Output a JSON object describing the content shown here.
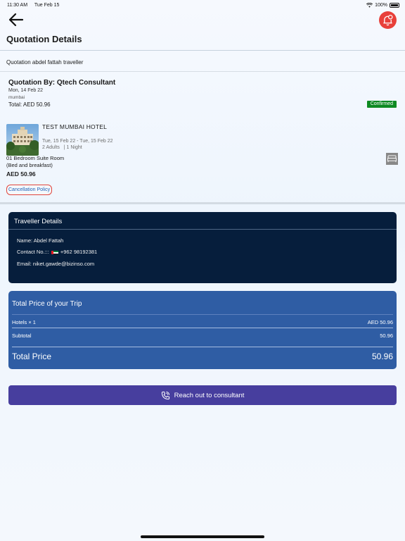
{
  "status_bar": {
    "time": "11:30 AM",
    "date": "Tue Feb 15",
    "battery": "100%"
  },
  "header": {
    "title": "Quotation Details"
  },
  "quotation": {
    "name": "Quotation abdel fattah traveller",
    "by": "Quotation By: Qtech Consultant",
    "date": "Mon, 14 Feb 22",
    "city": "mumbai",
    "total": "Total: AED 50.96",
    "status": "Confirmed",
    "status_color": "#0e8a22"
  },
  "hotel": {
    "name": "TEST MUMBAI HOTEL",
    "dates": "Tue, 15 Feb 22 - Tue, 15 Feb 22",
    "occupancy": "2 Adults   | 1 Night",
    "room_type": "01 Bedroom Suite Room",
    "board": "(Bed and breakfast)",
    "price": "AED 50.96",
    "cancellation_label": "Cancellation Policy",
    "icons": {
      "room": "bed-icon",
      "image": "hotel-photo"
    }
  },
  "traveller": {
    "title": "Traveller Details",
    "name": "Name: Abdel Fattah",
    "contact_label": "Contact No.:::",
    "contact_number": "+962 98192381",
    "email": "Email: niket.gawde@bizinso.com"
  },
  "pricing": {
    "title": "Total Price of your Trip",
    "hotels_label": "Hotels × 1",
    "hotels_value": "AED 50.96",
    "subtotal_label": "Subtotal",
    "subtotal_value": "50.96",
    "total_label": "Total Price",
    "total_value": "50.96"
  },
  "actions": {
    "reach_out": "Reach out to consultant"
  },
  "colors": {
    "traveller_card": "#061e3c",
    "price_card": "#2f5da4",
    "reach_button": "#473e9e",
    "notification": "#e8403a"
  }
}
